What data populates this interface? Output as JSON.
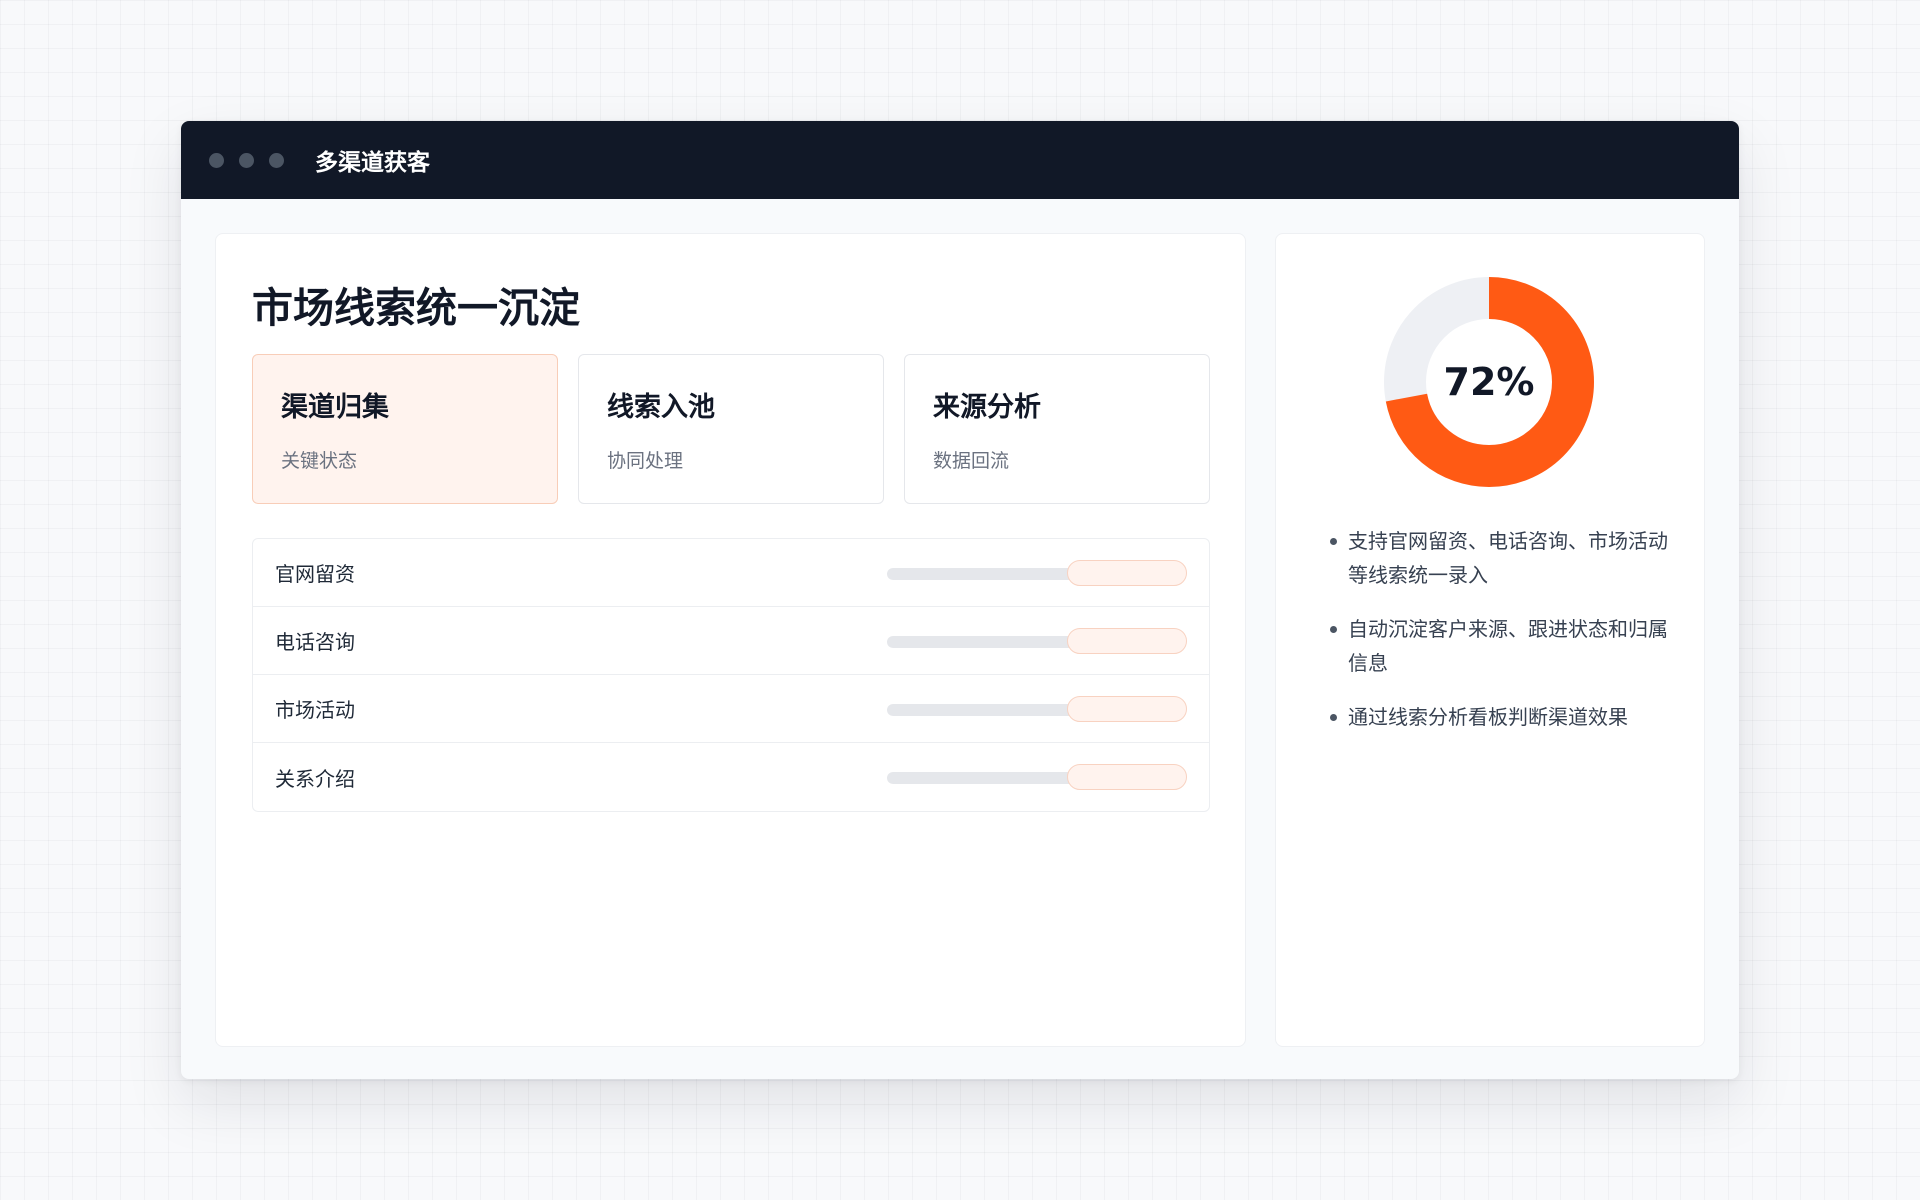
{
  "window": {
    "title": "多渠道获客"
  },
  "main": {
    "title": "市场线索统一沉淀",
    "tiles": [
      {
        "title": "渠道归集",
        "subtitle": "关键状态"
      },
      {
        "title": "线索入池",
        "subtitle": "协同处理"
      },
      {
        "title": "来源分析",
        "subtitle": "数据回流"
      }
    ],
    "channels": [
      {
        "label": "官网留资"
      },
      {
        "label": "电话咨询"
      },
      {
        "label": "市场活动"
      },
      {
        "label": "关系介绍"
      }
    ]
  },
  "side": {
    "percent_value": 72,
    "percent_label": "72%",
    "bullets": [
      "支持官网留资、电话咨询、市场活动等线索统一录入",
      "自动沉淀客户来源、跟进状态和归属信息",
      "通过线索分析看板判断渠道效果"
    ]
  },
  "colors": {
    "accent": "#ff5a14",
    "ring_track": "#eef0f4",
    "titlebar": "#111827",
    "active_tile_bg": "#fff3ee"
  }
}
